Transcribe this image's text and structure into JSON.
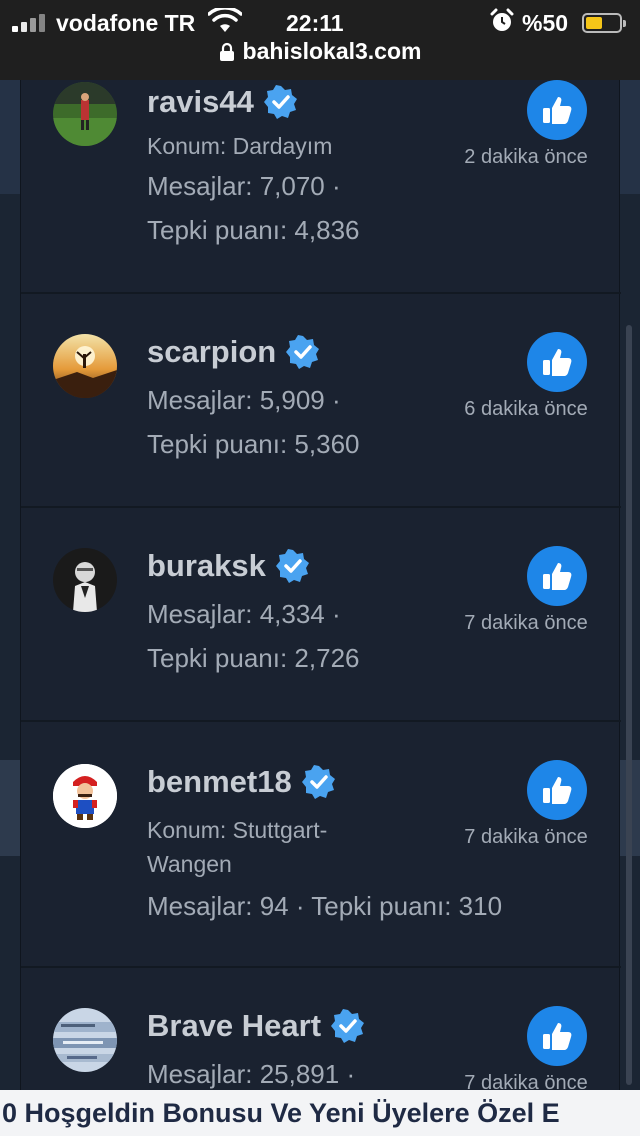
{
  "status_bar": {
    "carrier": "vodafone TR",
    "time": "22:11",
    "battery_percent": "%50",
    "url": "bahislokal3.com"
  },
  "members": [
    {
      "username": "ravis44",
      "location": "Konum: Dardayım",
      "messages": "Mesajlar: 7,070 ·",
      "reactions": "Tepki puanı: 4,836",
      "time": "2 dakika önce",
      "avatar": "stadium-avatar"
    },
    {
      "username": "scarpion",
      "messages": "Mesajlar: 5,909 ·",
      "reactions": "Tepki puanı: 5,360",
      "time": "6 dakika önce",
      "avatar": "sunset-avatar"
    },
    {
      "username": "buraksk",
      "messages": "Mesajlar: 4,334 ·",
      "reactions": "Tepki puanı: 2,726",
      "time": "7 dakika önce",
      "avatar": "portrait-avatar"
    },
    {
      "username": "benmet18",
      "location_line1": "Konum: Stuttgart-",
      "location_line2": "Wangen",
      "stats": "Mesajlar: 94 · Tepki puanı: 310",
      "time": "7 dakika önce",
      "avatar": "mario-avatar"
    },
    {
      "username": "Brave Heart",
      "messages": "Mesajlar: 25,891 ·",
      "time": "7 dakika önce",
      "avatar": "text-avatar"
    }
  ],
  "ticker": {
    "text": "0 Hoşgeldin Bonusu Ve Yeni Üyelere Özel E"
  },
  "colors": {
    "like_button": "#1e86e8",
    "verified_badge": "#4aa3f0",
    "panel_bg": "#1a2230",
    "username": "#c8cdd4"
  },
  "icons": [
    "signal-icon",
    "wifi-icon",
    "alarm-icon",
    "battery-icon",
    "lock-icon",
    "verified-badge-icon",
    "thumbs-up-icon"
  ]
}
